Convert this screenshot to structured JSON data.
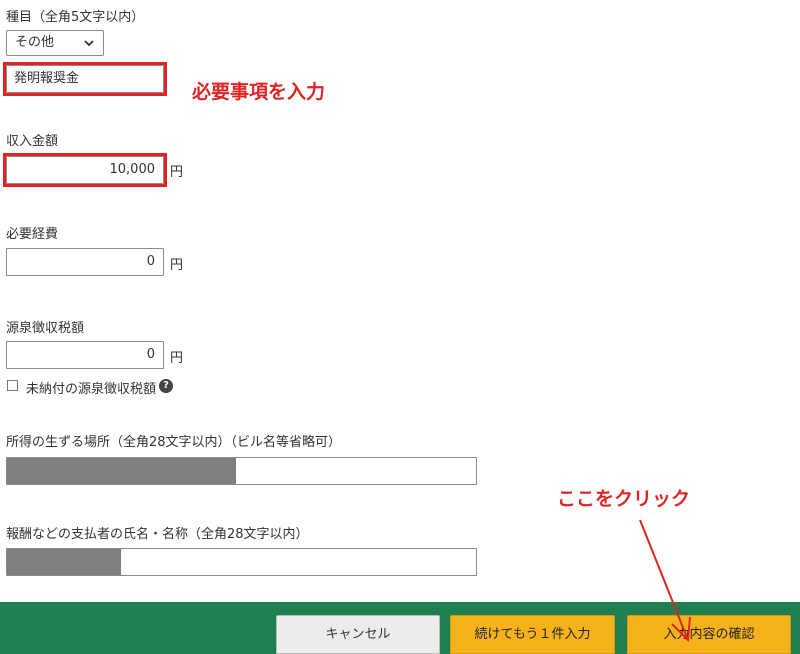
{
  "category": {
    "label": "種目（全角5文字以内）",
    "select_value": "その他",
    "input_value": "発明報奨金"
  },
  "income": {
    "label": "収入金額",
    "value": "10,000",
    "unit": "円"
  },
  "expenses": {
    "label": "必要経費",
    "value": "0",
    "unit": "円"
  },
  "withholding": {
    "label": "源泉徴収税額",
    "value": "0",
    "unit": "円",
    "unpaid_label": "未納付の源泉徴収税額",
    "help_glyph": "?"
  },
  "location": {
    "label": "所得の生ずる場所（全角28文字以内）（ビル名等省略可）"
  },
  "payer": {
    "label": "報酬などの支払者の氏名・名称（全角28文字以内）"
  },
  "annotations": {
    "input_required": "必要事項を入力",
    "click_here": "ここをクリック",
    "color": "#e02424"
  },
  "footer": {
    "cancel_label": "キャンセル",
    "continue_label": "続けてもう１件入力",
    "confirm_label": "入力内容の確認",
    "bg_color": "#1e8050",
    "accent_color": "#f6b21b"
  }
}
